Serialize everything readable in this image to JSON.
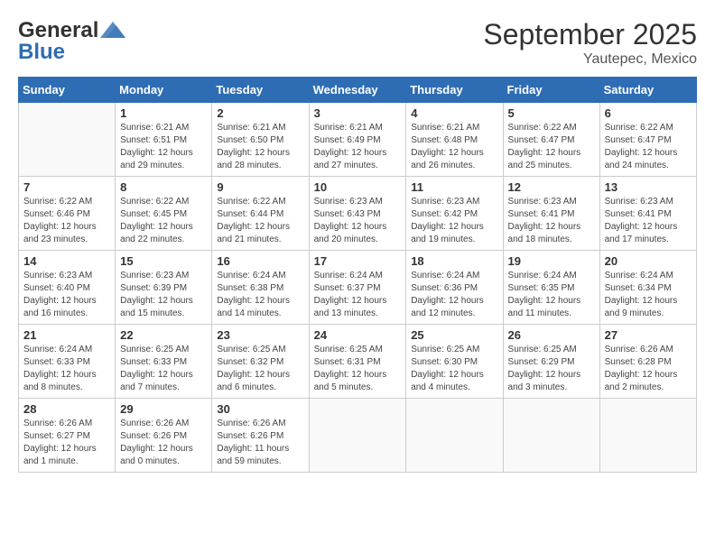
{
  "header": {
    "logo_line1": "General",
    "logo_line2": "Blue",
    "month": "September 2025",
    "location": "Yautepec, Mexico"
  },
  "days_of_week": [
    "Sunday",
    "Monday",
    "Tuesday",
    "Wednesday",
    "Thursday",
    "Friday",
    "Saturday"
  ],
  "weeks": [
    [
      {
        "day": "",
        "info": ""
      },
      {
        "day": "1",
        "info": "Sunrise: 6:21 AM\nSunset: 6:51 PM\nDaylight: 12 hours\nand 29 minutes."
      },
      {
        "day": "2",
        "info": "Sunrise: 6:21 AM\nSunset: 6:50 PM\nDaylight: 12 hours\nand 28 minutes."
      },
      {
        "day": "3",
        "info": "Sunrise: 6:21 AM\nSunset: 6:49 PM\nDaylight: 12 hours\nand 27 minutes."
      },
      {
        "day": "4",
        "info": "Sunrise: 6:21 AM\nSunset: 6:48 PM\nDaylight: 12 hours\nand 26 minutes."
      },
      {
        "day": "5",
        "info": "Sunrise: 6:22 AM\nSunset: 6:47 PM\nDaylight: 12 hours\nand 25 minutes."
      },
      {
        "day": "6",
        "info": "Sunrise: 6:22 AM\nSunset: 6:47 PM\nDaylight: 12 hours\nand 24 minutes."
      }
    ],
    [
      {
        "day": "7",
        "info": "Sunrise: 6:22 AM\nSunset: 6:46 PM\nDaylight: 12 hours\nand 23 minutes."
      },
      {
        "day": "8",
        "info": "Sunrise: 6:22 AM\nSunset: 6:45 PM\nDaylight: 12 hours\nand 22 minutes."
      },
      {
        "day": "9",
        "info": "Sunrise: 6:22 AM\nSunset: 6:44 PM\nDaylight: 12 hours\nand 21 minutes."
      },
      {
        "day": "10",
        "info": "Sunrise: 6:23 AM\nSunset: 6:43 PM\nDaylight: 12 hours\nand 20 minutes."
      },
      {
        "day": "11",
        "info": "Sunrise: 6:23 AM\nSunset: 6:42 PM\nDaylight: 12 hours\nand 19 minutes."
      },
      {
        "day": "12",
        "info": "Sunrise: 6:23 AM\nSunset: 6:41 PM\nDaylight: 12 hours\nand 18 minutes."
      },
      {
        "day": "13",
        "info": "Sunrise: 6:23 AM\nSunset: 6:41 PM\nDaylight: 12 hours\nand 17 minutes."
      }
    ],
    [
      {
        "day": "14",
        "info": "Sunrise: 6:23 AM\nSunset: 6:40 PM\nDaylight: 12 hours\nand 16 minutes."
      },
      {
        "day": "15",
        "info": "Sunrise: 6:23 AM\nSunset: 6:39 PM\nDaylight: 12 hours\nand 15 minutes."
      },
      {
        "day": "16",
        "info": "Sunrise: 6:24 AM\nSunset: 6:38 PM\nDaylight: 12 hours\nand 14 minutes."
      },
      {
        "day": "17",
        "info": "Sunrise: 6:24 AM\nSunset: 6:37 PM\nDaylight: 12 hours\nand 13 minutes."
      },
      {
        "day": "18",
        "info": "Sunrise: 6:24 AM\nSunset: 6:36 PM\nDaylight: 12 hours\nand 12 minutes."
      },
      {
        "day": "19",
        "info": "Sunrise: 6:24 AM\nSunset: 6:35 PM\nDaylight: 12 hours\nand 11 minutes."
      },
      {
        "day": "20",
        "info": "Sunrise: 6:24 AM\nSunset: 6:34 PM\nDaylight: 12 hours\nand 9 minutes."
      }
    ],
    [
      {
        "day": "21",
        "info": "Sunrise: 6:24 AM\nSunset: 6:33 PM\nDaylight: 12 hours\nand 8 minutes."
      },
      {
        "day": "22",
        "info": "Sunrise: 6:25 AM\nSunset: 6:33 PM\nDaylight: 12 hours\nand 7 minutes."
      },
      {
        "day": "23",
        "info": "Sunrise: 6:25 AM\nSunset: 6:32 PM\nDaylight: 12 hours\nand 6 minutes."
      },
      {
        "day": "24",
        "info": "Sunrise: 6:25 AM\nSunset: 6:31 PM\nDaylight: 12 hours\nand 5 minutes."
      },
      {
        "day": "25",
        "info": "Sunrise: 6:25 AM\nSunset: 6:30 PM\nDaylight: 12 hours\nand 4 minutes."
      },
      {
        "day": "26",
        "info": "Sunrise: 6:25 AM\nSunset: 6:29 PM\nDaylight: 12 hours\nand 3 minutes."
      },
      {
        "day": "27",
        "info": "Sunrise: 6:26 AM\nSunset: 6:28 PM\nDaylight: 12 hours\nand 2 minutes."
      }
    ],
    [
      {
        "day": "28",
        "info": "Sunrise: 6:26 AM\nSunset: 6:27 PM\nDaylight: 12 hours\nand 1 minute."
      },
      {
        "day": "29",
        "info": "Sunrise: 6:26 AM\nSunset: 6:26 PM\nDaylight: 12 hours\nand 0 minutes."
      },
      {
        "day": "30",
        "info": "Sunrise: 6:26 AM\nSunset: 6:26 PM\nDaylight: 11 hours\nand 59 minutes."
      },
      {
        "day": "",
        "info": ""
      },
      {
        "day": "",
        "info": ""
      },
      {
        "day": "",
        "info": ""
      },
      {
        "day": "",
        "info": ""
      }
    ]
  ]
}
